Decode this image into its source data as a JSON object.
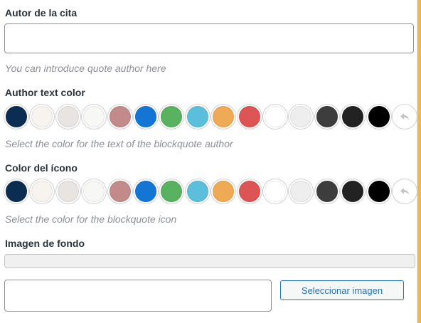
{
  "quote_author": {
    "label": "Autor de la cita",
    "value": "",
    "help": "You can introduce quote author here"
  },
  "author_text_color": {
    "label": "Author text color",
    "help": "Select the color for the text of the blockquote author"
  },
  "icon_color": {
    "label": "Color del ícono",
    "help": "Select the color for the blockquote icon"
  },
  "palette": [
    "#0b2d52",
    "#f7f3ee",
    "#e8e4e1",
    "#f7f7f5",
    "#c28a8a",
    "#1376d4",
    "#58b25f",
    "#5bbfdc",
    "#eeaa55",
    "#dd5454",
    "#ffffff",
    "#eeeeee",
    "#3d3d3d",
    "#222222",
    "#000000"
  ],
  "reset_icon": "undo-arrow-icon",
  "background_image": {
    "label": "Imagen de fondo",
    "select_label": "Seleccionar imagen"
  }
}
